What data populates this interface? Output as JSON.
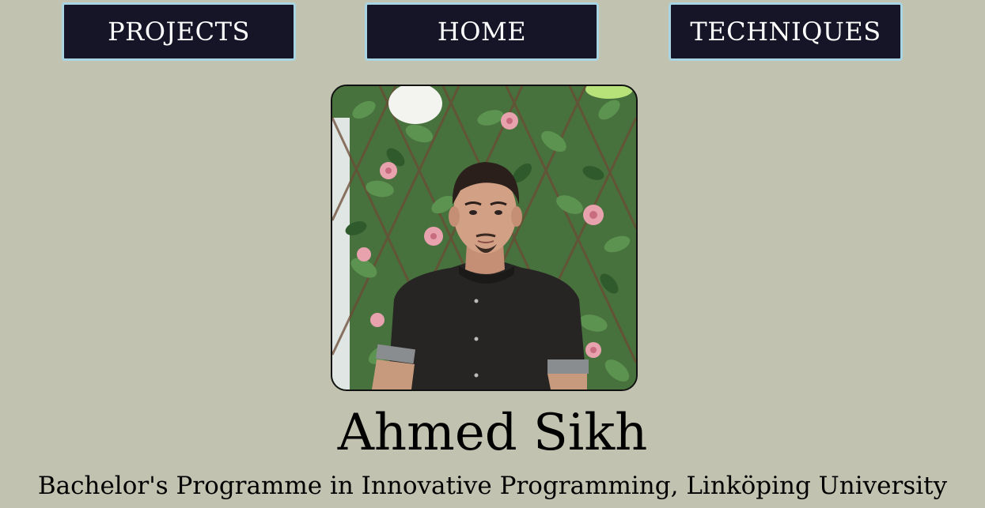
{
  "nav": {
    "projects_label": "PROJECTS",
    "home_label": "HOME",
    "techniques_label": "TECHNIQUES"
  },
  "profile": {
    "photo_alt": "Portrait of Ahmed Sikh",
    "name": "Ahmed Sikh",
    "subtitle": "Bachelor's Programme in Innovative Programming, Linköping University"
  },
  "colors": {
    "background": "#c1c2b0",
    "nav_button_bg": "#161527",
    "nav_button_border": "#a9d4e2",
    "nav_button_text": "#ffffff"
  }
}
